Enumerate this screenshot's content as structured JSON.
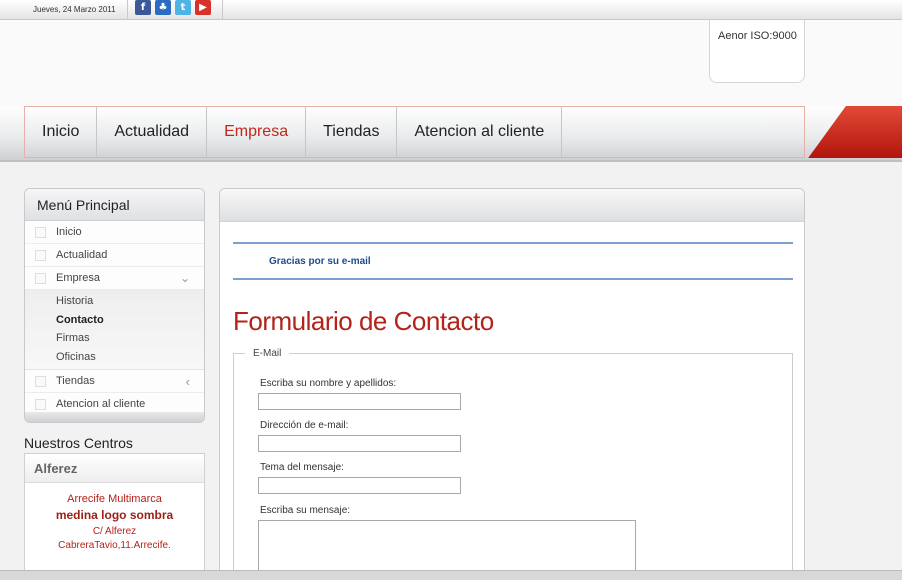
{
  "topbar": {
    "date": "Jueves, 24 Marzo 2011",
    "social": [
      {
        "icon": "facebook-icon",
        "glyph": "f",
        "color": "#3b5998"
      },
      {
        "icon": "messenger-icon",
        "glyph": "♣",
        "color": "#2a6cc4"
      },
      {
        "icon": "twitter-icon",
        "glyph": "t",
        "color": "#4fb3e6"
      },
      {
        "icon": "youtube-icon",
        "glyph": "▶",
        "color": "#d8312a"
      }
    ]
  },
  "header": {
    "iso": "Aenor ISO:9000"
  },
  "nav": {
    "items": [
      {
        "label": "Inicio",
        "active": false
      },
      {
        "label": "Actualidad",
        "active": false
      },
      {
        "label": "Empresa",
        "active": true
      },
      {
        "label": "Tiendas",
        "active": false
      },
      {
        "label": "Atencion al cliente",
        "active": false
      }
    ],
    "accent": "#c0281c"
  },
  "sidebar": {
    "title": "Menú Principal",
    "items": [
      {
        "label": "Inicio"
      },
      {
        "label": "Actualidad"
      },
      {
        "label": "Empresa",
        "expanded": true
      },
      {
        "label": "Tiendas",
        "collapsed": true
      },
      {
        "label": "Atencion al cliente"
      }
    ],
    "submenu": [
      {
        "label": "Historia",
        "current": false
      },
      {
        "label": "Contacto",
        "current": true
      },
      {
        "label": "Firmas",
        "current": false
      },
      {
        "label": "Oficinas",
        "current": false
      }
    ]
  },
  "centros": {
    "title": "Nuestros Centros",
    "name": "Alferez",
    "line1": "Arrecife Multimarca",
    "line2": "medina logo sombra",
    "line3": "C/ Alferez",
    "line4": "CabreraTavio,11.Arrecife."
  },
  "main": {
    "message": "Gracias por su e-mail",
    "title": "Formulario de Contacto",
    "fieldset_legend": "E-Mail",
    "fields": {
      "name_label": "Escriba su nombre y apellidos:",
      "email_label": "Dirección de e-mail:",
      "subject_label": "Tema del mensaje:",
      "message_label": "Escriba su mensaje:"
    }
  }
}
